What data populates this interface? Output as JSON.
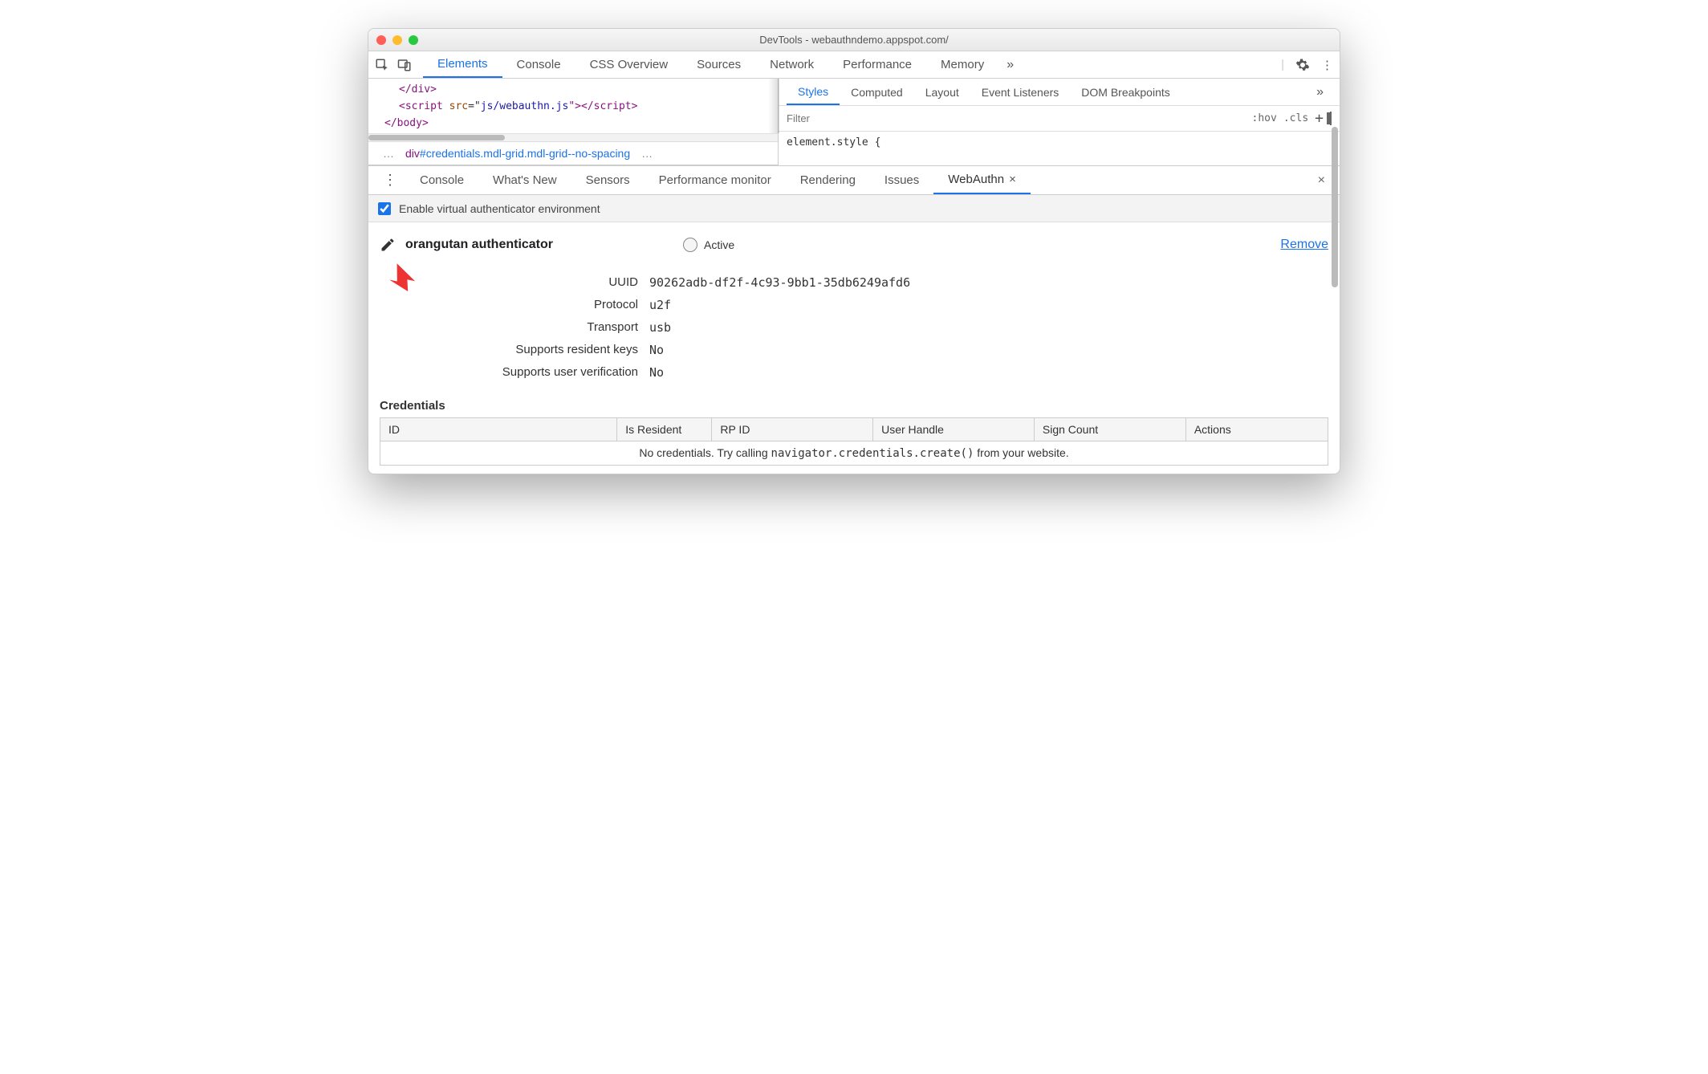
{
  "window": {
    "title": "DevTools - webauthndemo.appspot.com/"
  },
  "mainTabs": [
    "Elements",
    "Console",
    "CSS Overview",
    "Sources",
    "Network",
    "Performance",
    "Memory"
  ],
  "mainTabsActive": "Elements",
  "elementsSource": {
    "line1_indent": "</div>",
    "line2_pre": "<script ",
    "line2_attr": "src",
    "line2_eq": "=\"",
    "line2_val": "js/webauthn.js",
    "line2_post": "\"></script>",
    "line3": "</body>"
  },
  "crumb": {
    "tag": "div",
    "id": "#credentials",
    "classes": ".mdl-grid.mdl-grid--no-spacing"
  },
  "sideTabs": [
    "Styles",
    "Computed",
    "Layout",
    "Event Listeners",
    "DOM Breakpoints"
  ],
  "sideTabsActive": "Styles",
  "filter": {
    "placeholder": "Filter",
    "hov": ":hov",
    "cls": ".cls"
  },
  "styleBody": "element.style {",
  "drawerTabs": [
    "Console",
    "What's New",
    "Sensors",
    "Performance monitor",
    "Rendering",
    "Issues",
    "WebAuthn"
  ],
  "drawerActive": "WebAuthn",
  "enable": {
    "label": "Enable virtual authenticator environment",
    "checked": true
  },
  "authenticator": {
    "name": "orangutan authenticator",
    "activeLabel": "Active",
    "removeLabel": "Remove",
    "fields": {
      "uuid_k": "UUID",
      "uuid_v": "90262adb-df2f-4c93-9bb1-35db6249afd6",
      "proto_k": "Protocol",
      "proto_v": "u2f",
      "trans_k": "Transport",
      "trans_v": "usb",
      "rk_k": "Supports resident keys",
      "rk_v": "No",
      "uv_k": "Supports user verification",
      "uv_v": "No"
    }
  },
  "credentials": {
    "heading": "Credentials",
    "cols": [
      "ID",
      "Is Resident",
      "RP ID",
      "User Handle",
      "Sign Count",
      "Actions"
    ],
    "empty_pre": "No credentials. Try calling ",
    "empty_code": "navigator.credentials.create()",
    "empty_post": " from your website."
  }
}
